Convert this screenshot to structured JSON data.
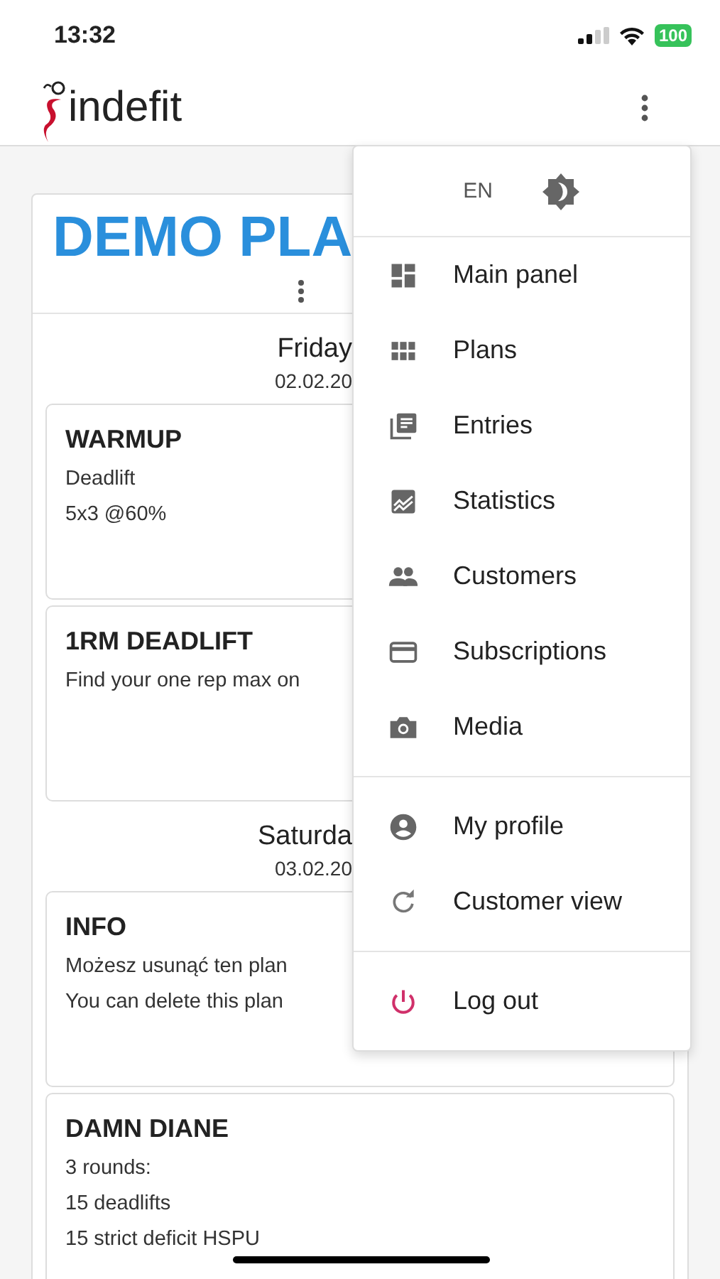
{
  "status_bar": {
    "time": "13:32",
    "battery": "100"
  },
  "app_bar": {
    "logo_text": "indefit"
  },
  "plan": {
    "title": "DEMO PLA",
    "days": [
      {
        "name": "Friday",
        "date": "02.02.20",
        "entries": [
          {
            "title": "WARMUP",
            "lines": [
              "Deadlift",
              "5x3 @60%"
            ]
          },
          {
            "title": "1RM DEADLIFT",
            "lines": [
              "Find your one rep max on"
            ]
          }
        ]
      },
      {
        "name": "Saturda",
        "date": "03.02.20",
        "entries": [
          {
            "title": "INFO",
            "lines": [
              "Możesz usunąć ten plan",
              "You can delete this plan"
            ]
          },
          {
            "title": "DAMN DIANE",
            "lines": [
              "3 rounds:",
              "15 deadlifts",
              "15 strict deficit HSPU"
            ]
          }
        ]
      }
    ]
  },
  "menu": {
    "language": "EN",
    "sections": [
      [
        "Main panel",
        "Plans",
        "Entries",
        "Statistics",
        "Customers",
        "Subscriptions",
        "Media"
      ],
      [
        "My profile",
        "Customer view"
      ],
      [
        "Log out"
      ]
    ]
  }
}
